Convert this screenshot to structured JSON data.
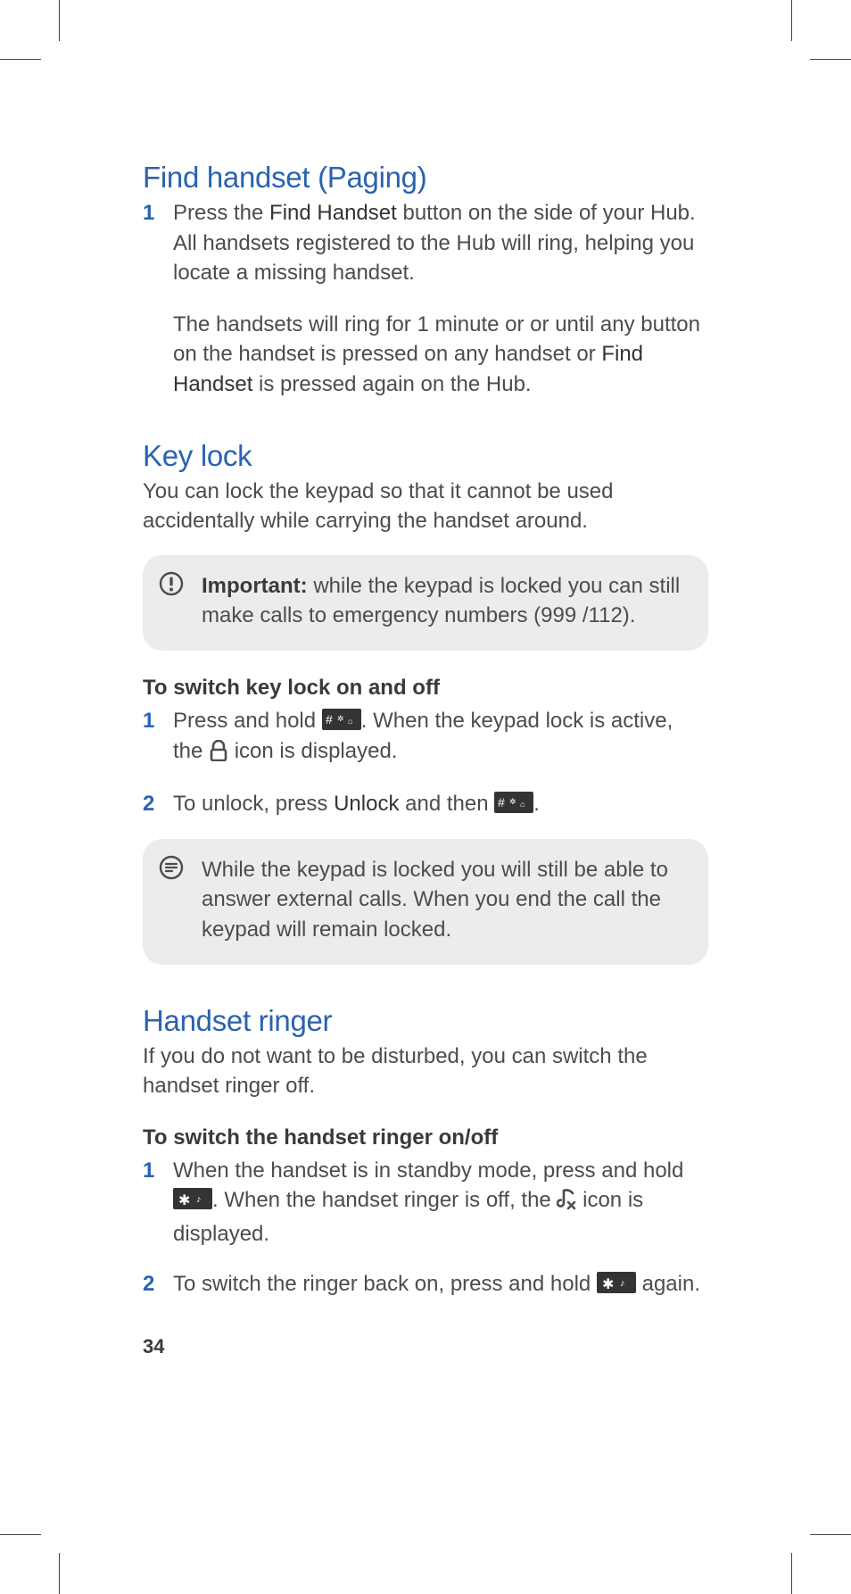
{
  "sections": {
    "find_handset": {
      "title": "Find handset (Paging)",
      "step1_num": "1",
      "step1a_pre": "Press the ",
      "step1a_btn": "Find Handset",
      "step1a_post": " button on the side of your Hub. All handsets registered to the Hub will ring, helping you locate a missing handset.",
      "step1b_pre": "The handsets will ring for 1 minute or or until any button on the handset is pressed on any handset or ",
      "step1b_btn": "Find Handset",
      "step1b_post": " is pressed again on the Hub."
    },
    "key_lock": {
      "title": "Key lock",
      "intro": "You can lock the keypad so that it cannot be used accidentally while carrying the handset around.",
      "important_label": "Important:",
      "important_text": "  while the keypad is locked you can still make calls to emergency numbers (999 /112).",
      "sub_head": "To switch key lock on and off",
      "step1_num": "1",
      "step1_pre": "Press and hold ",
      "step1_mid": ". When the keypad lock is active, the ",
      "step1_post": " icon is displayed.",
      "step2_num": "2",
      "step2_pre": "To unlock, press ",
      "step2_btn": "Unlock",
      "step2_mid": " and then ",
      "step2_post": ".",
      "note": "While the keypad is locked you will still be able to answer external calls. When you end the call the keypad will remain locked."
    },
    "handset_ringer": {
      "title": "Handset ringer",
      "intro": "If you do not want to be disturbed, you can switch the handset ringer off.",
      "sub_head": "To switch the handset ringer on/off",
      "step1_num": "1",
      "step1_pre": "When the handset is in standby mode, press and hold ",
      "step1_mid": ". When the handset ringer is off, the ",
      "step1_post": " icon is displayed.",
      "step2_num": "2",
      "step2_pre": "To switch the ringer back on, press and hold ",
      "step2_post": " again."
    }
  },
  "page_number": "34",
  "icons": {
    "hash_key": "hash-key",
    "star_key": "star-key",
    "lock": "lock-icon",
    "ringer_off": "ringer-off-icon",
    "important": "important-icon",
    "note": "note-icon"
  }
}
